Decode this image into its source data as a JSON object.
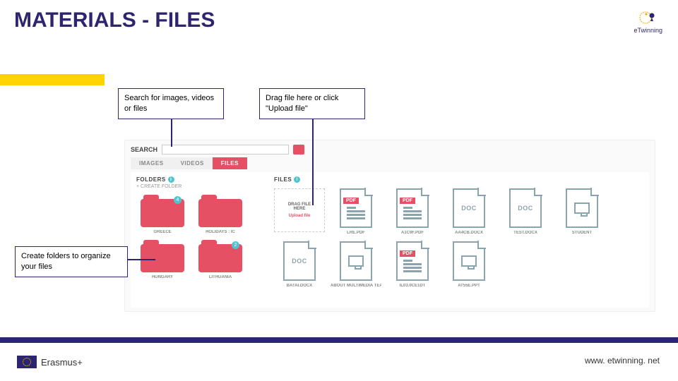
{
  "title": "MATERIALS - FILES",
  "logoText": "eTwinning",
  "callouts": {
    "search": "Search for images, videos or files",
    "drag": "Drag file here or click \"Upload file\"",
    "folders": "Create folders to organize your files"
  },
  "panel": {
    "searchLabel": "Search",
    "tabs": [
      "IMAGES",
      "VIDEOS",
      "FILES"
    ],
    "activeTab": 2,
    "foldersHead": "FOLDERS",
    "createFolder": "+ CREATE FOLDER",
    "filesHead": "FILES",
    "folders": [
      {
        "name": "GREECE",
        "badge": "4"
      },
      {
        "name": "HOLIDAYS : IC",
        "badge": ""
      },
      {
        "name": "HUNGARY",
        "badge": ""
      },
      {
        "name": "LITHUANIA",
        "badge": "2"
      }
    ],
    "dropzone": {
      "line1": "DRAG FILE",
      "line2": "HERE",
      "upload": "Upload file"
    },
    "files": [
      {
        "name": "LRE.PDF",
        "tag": "PDF",
        "inner": "lines"
      },
      {
        "name": "A1C9F.PDF",
        "tag": "PDF",
        "inner": "lines"
      },
      {
        "name": "AA4CB.DOCX",
        "tag": "",
        "inner": "ext",
        "ext": "DOC"
      },
      {
        "name": "TEST.DOCX",
        "tag": "",
        "inner": "ext",
        "ext": "DOC"
      },
      {
        "name": "STUDENT",
        "tag": "",
        "inner": "monitor"
      },
      {
        "name": "BATAI.DOCX",
        "tag": "",
        "inner": "ext",
        "ext": "DOC"
      },
      {
        "name": "ABOUT MULTIMEDIA TEAM.PPTX",
        "tag": "",
        "inner": "monitor"
      },
      {
        "name": "IL03.0CE1DT",
        "tag": "PDF",
        "inner": "lines"
      },
      {
        "name": "AT55E.PPT",
        "tag": "",
        "inner": "monitor"
      }
    ]
  },
  "footer": {
    "left": "Erasmus+",
    "right": "www. etwinning. net"
  }
}
